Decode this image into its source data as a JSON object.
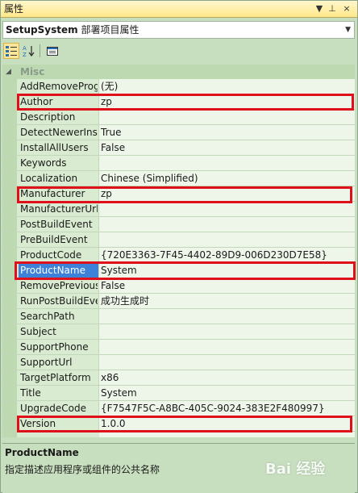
{
  "window": {
    "title": "属性",
    "dropdown_glyph": "▼",
    "pin_glyph": "⊥",
    "close_glyph": "×"
  },
  "object": {
    "name": "SetupSystem",
    "type": "部署项目属性"
  },
  "toolbar": {
    "categorized_icon": "categorized-icon",
    "alphabetical_icon": "alphabetical-icon",
    "property_pages_icon": "property-pages-icon"
  },
  "category": {
    "name": "Misc",
    "expanded": true
  },
  "properties": [
    {
      "name": "AddRemoveProg",
      "value": "(无)"
    },
    {
      "name": "Author",
      "value": "zp"
    },
    {
      "name": "Description",
      "value": ""
    },
    {
      "name": "DetectNewerInst",
      "value": "True"
    },
    {
      "name": "InstallAllUsers",
      "value": "False"
    },
    {
      "name": "Keywords",
      "value": ""
    },
    {
      "name": "Localization",
      "value": "Chinese (Simplified)"
    },
    {
      "name": "Manufacturer",
      "value": "zp"
    },
    {
      "name": "ManufacturerUrl",
      "value": ""
    },
    {
      "name": "PostBuildEvent",
      "value": ""
    },
    {
      "name": "PreBuildEvent",
      "value": ""
    },
    {
      "name": "ProductCode",
      "value": "{720E3363-7F45-4402-89D9-006D230D7E58}"
    },
    {
      "name": "ProductName",
      "value": "System"
    },
    {
      "name": "RemovePrevious",
      "value": "False"
    },
    {
      "name": "RunPostBuildEve",
      "value": "成功生成时"
    },
    {
      "name": "SearchPath",
      "value": ""
    },
    {
      "name": "Subject",
      "value": ""
    },
    {
      "name": "SupportPhone",
      "value": ""
    },
    {
      "name": "SupportUrl",
      "value": ""
    },
    {
      "name": "TargetPlatform",
      "value": "x86"
    },
    {
      "name": "Title",
      "value": "System"
    },
    {
      "name": "UpgradeCode",
      "value": "{F7547F5C-A8BC-405C-9024-383E2F480997}"
    },
    {
      "name": "Version",
      "value": "1.0.0"
    }
  ],
  "selected_property": "ProductName",
  "highlighted_properties": [
    "Author",
    "Manufacturer",
    "ProductName",
    "Version"
  ],
  "description": {
    "title": "ProductName",
    "text": "指定描述应用程序或组件的公共名称"
  },
  "watermark": "Bai 经验",
  "colors": {
    "highlight_box": "#e0101a",
    "selection": "#3d82d8",
    "pane_bg": "#c8dfbf"
  }
}
